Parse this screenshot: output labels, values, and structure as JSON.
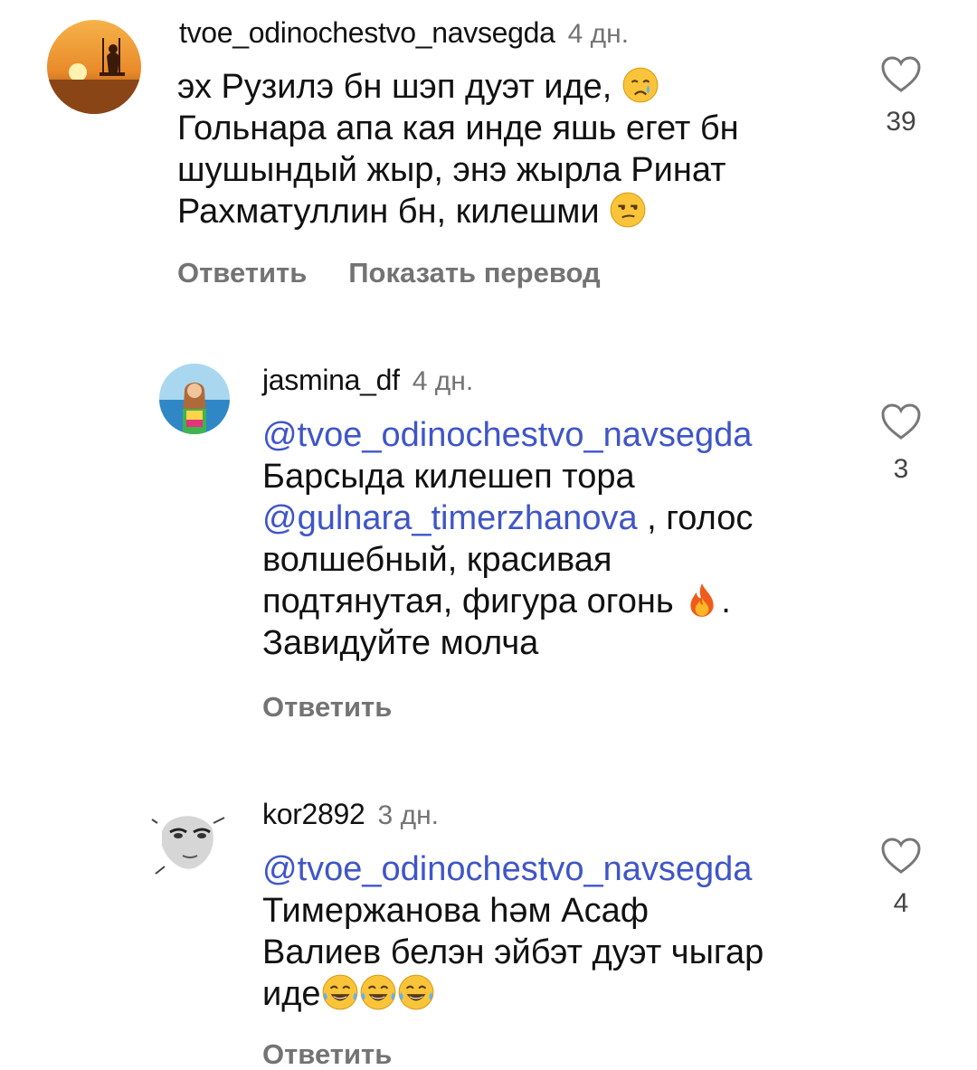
{
  "comments": [
    {
      "username": "tvoe_odinochestvo_navsegda",
      "time": "4 дн.",
      "lines": [
        {
          "text": "эх Рузилэ бн шэп дуэт иде,",
          "emoji": "crying-face-icon"
        },
        {
          "text": "Гольнара апа кая инде яшь егет бн"
        },
        {
          "text": "шушындый жыр, энэ жырла Ринат"
        },
        {
          "text": "Рахматуллин бн, килешми",
          "emoji": "unamused-face-icon"
        }
      ],
      "reply_label": "Ответить",
      "translate_label": "Показать перевод",
      "likes": "39"
    },
    {
      "username": "jasmina_df",
      "time": "4 дн.",
      "mention1": "@tvoe_odinochestvo_navsegda",
      "line2": "Барсыда килешеп тора",
      "mention2": "@gulnara_timerzhanova",
      "line3_rest": " , голос",
      "line4": "волшебный, красивая",
      "line5": "подтянутая, фигура огонь",
      "line5_tail": ".",
      "line6": "Завидуйте молча",
      "reply_label": "Ответить",
      "likes": "3"
    },
    {
      "username": "kor2892",
      "time": "3 дн.",
      "mention1": "@tvoe_odinochestvo_navsegda",
      "line2": "Тимержанова һәм Асаф",
      "line3": "Валиев белэн эйбэт дуэт чыгар",
      "line4": "иде",
      "reply_label": "Ответить",
      "likes": "4"
    }
  ],
  "colors": {
    "mention": "#3f55c8",
    "secondary": "#737373"
  }
}
